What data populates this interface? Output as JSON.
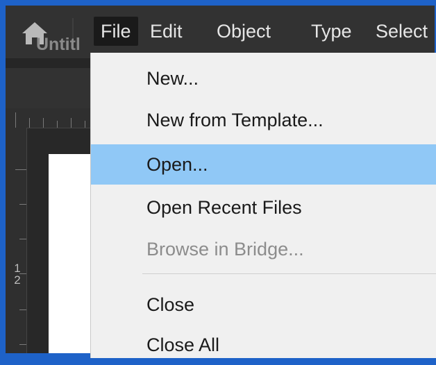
{
  "menubar": {
    "items": [
      "File",
      "Edit",
      "Object",
      "Type",
      "Select"
    ],
    "active": "File"
  },
  "document": {
    "tab_title": "Untitl",
    "ruler_value": "1\n2"
  },
  "file_menu": {
    "items": [
      {
        "label": "New...",
        "state": "normal"
      },
      {
        "label": "New from Template...",
        "state": "normal"
      },
      {
        "label": "Open...",
        "state": "highlighted"
      },
      {
        "label": "Open Recent Files",
        "state": "normal"
      },
      {
        "label": "Browse in Bridge...",
        "state": "disabled"
      },
      {
        "label": "Close",
        "state": "normal"
      },
      {
        "label": "Close All",
        "state": "normal"
      }
    ]
  },
  "icons": {
    "home": "home-icon"
  },
  "colors": {
    "border": "#1e62c8",
    "highlight": "#90c8f6",
    "menubar_bg": "#323232"
  }
}
